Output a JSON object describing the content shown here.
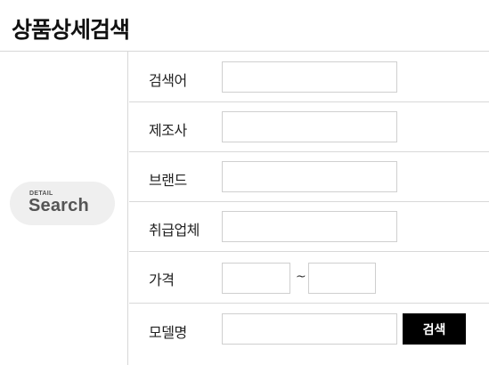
{
  "page": {
    "title": "상품상세검색"
  },
  "badge": {
    "small": "DETAIL",
    "big": "Search"
  },
  "rows": [
    {
      "label": "검색어",
      "value": "",
      "placeholder": ""
    },
    {
      "label": "제조사",
      "value": "",
      "placeholder": ""
    },
    {
      "label": "브랜드",
      "value": "",
      "placeholder": ""
    },
    {
      "label": "취급업체",
      "value": "",
      "placeholder": ""
    },
    {
      "label": "가격",
      "min": "",
      "max": "",
      "separator": "~"
    },
    {
      "label": "모델명",
      "value": "",
      "placeholder": ""
    }
  ],
  "button": {
    "label": "검색"
  }
}
